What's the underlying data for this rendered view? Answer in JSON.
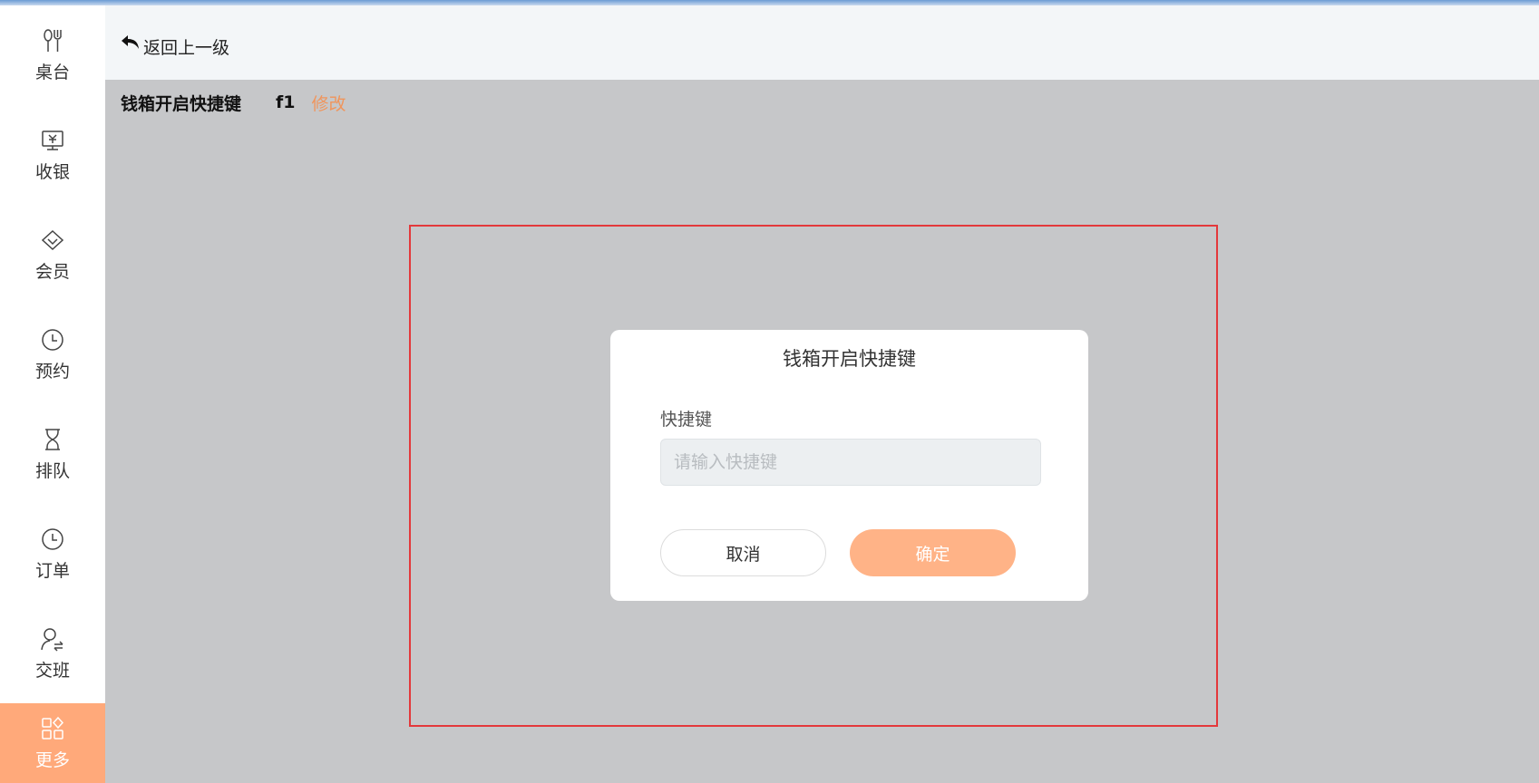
{
  "sidebar": {
    "items": [
      {
        "label": "桌台",
        "icon": "utensils-icon"
      },
      {
        "label": "收银",
        "icon": "cashier-icon"
      },
      {
        "label": "会员",
        "icon": "diamond-icon"
      },
      {
        "label": "预约",
        "icon": "clock-icon"
      },
      {
        "label": "排队",
        "icon": "hourglass-icon"
      },
      {
        "label": "订单",
        "icon": "clock-icon"
      },
      {
        "label": "交班",
        "icon": "user-swap-icon"
      },
      {
        "label": "更多",
        "icon": "grid-icon",
        "active": true
      }
    ],
    "active_color": "#ffa97a"
  },
  "header": {
    "back_label": "返回上一级"
  },
  "setting": {
    "title": "钱箱开启快捷键",
    "value": "f1",
    "edit_label": "修改"
  },
  "dialog": {
    "title": "钱箱开启快捷键",
    "field_label": "快捷键",
    "input_placeholder": "请输入快捷键",
    "input_value": "",
    "cancel_label": "取消",
    "confirm_label": "确定"
  },
  "colors": {
    "accent": "#ffb387",
    "edit_link": "#f0955c",
    "highlight_border": "#e3383b",
    "overlay": "#c6c7c9"
  }
}
